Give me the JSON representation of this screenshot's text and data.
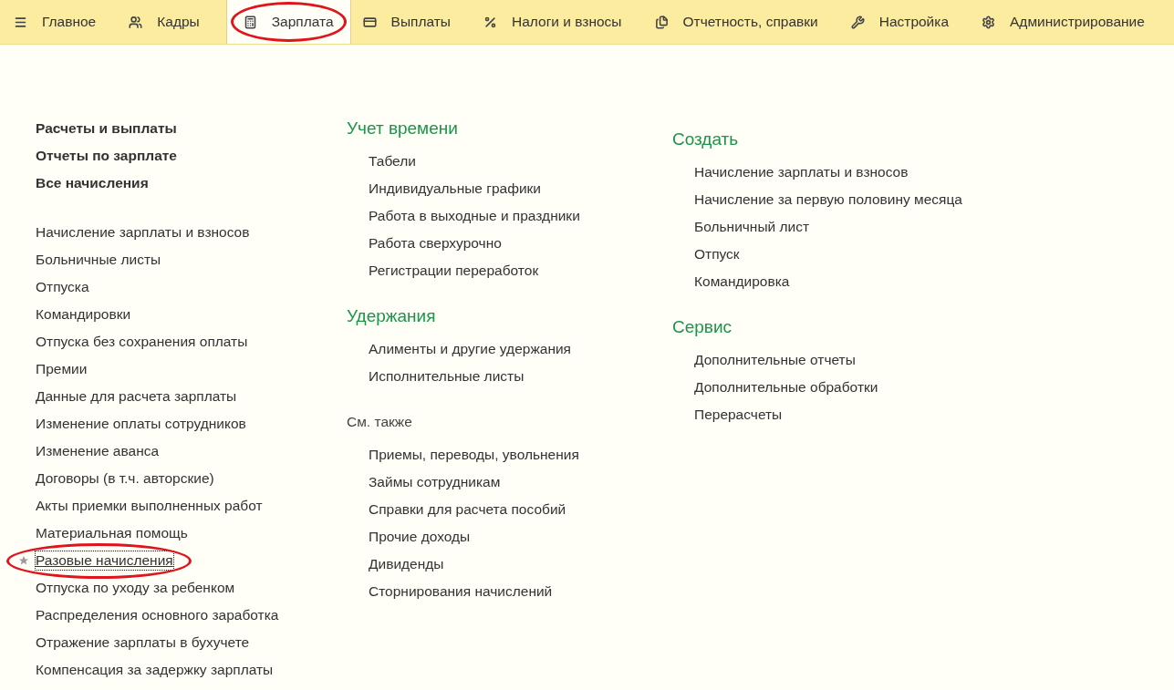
{
  "tabs": [
    {
      "label": "Главное",
      "selected": false,
      "circled": false
    },
    {
      "label": "Кадры",
      "selected": false,
      "circled": false
    },
    {
      "label": "Зарплата",
      "selected": true,
      "circled": true
    },
    {
      "label": "Выплаты",
      "selected": false,
      "circled": false
    },
    {
      "label": "Налоги и взносы",
      "selected": false,
      "circled": false
    },
    {
      "label": "Отчетность, справки",
      "selected": false,
      "circled": false
    },
    {
      "label": "Настройка",
      "selected": false,
      "circled": false
    },
    {
      "label": "Администрирование",
      "selected": false,
      "circled": false
    }
  ],
  "columns": [
    {
      "sections": [
        {
          "kind": "bold",
          "items": [
            {
              "label": "Расчеты и выплаты"
            },
            {
              "label": "Отчеты по зарплате"
            },
            {
              "label": "Все начисления"
            }
          ]
        },
        {
          "kind": "plain",
          "items": [
            {
              "label": "Начисление зарплаты и взносов"
            },
            {
              "label": "Больничные листы"
            },
            {
              "label": "Отпуска"
            },
            {
              "label": "Командировки"
            },
            {
              "label": "Отпуска без сохранения оплаты"
            },
            {
              "label": "Премии"
            },
            {
              "label": "Данные для расчета зарплаты"
            },
            {
              "label": "Изменение оплаты сотрудников"
            },
            {
              "label": "Изменение аванса"
            },
            {
              "label": "Договоры (в т.ч. авторские)"
            },
            {
              "label": "Акты приемки выполненных работ"
            },
            {
              "label": "Материальная помощь"
            },
            {
              "label": "Разовые начисления",
              "starred": true,
              "focused": true,
              "circled": true
            },
            {
              "label": "Отпуска по уходу за ребенком"
            },
            {
              "label": "Распределения основного заработка"
            },
            {
              "label": "Отражение зарплаты в бухучете"
            },
            {
              "label": "Компенсация за задержку зарплаты"
            }
          ]
        }
      ]
    },
    {
      "sections": [
        {
          "kind": "group",
          "title": "Учет времени",
          "items": [
            {
              "label": "Табели"
            },
            {
              "label": "Индивидуальные графики"
            },
            {
              "label": "Работа в выходные и праздники"
            },
            {
              "label": "Работа сверхурочно"
            },
            {
              "label": "Регистрации переработок"
            }
          ]
        },
        {
          "kind": "group",
          "title": "Удержания",
          "items": [
            {
              "label": "Алименты и другие удержания"
            },
            {
              "label": "Исполнительные листы"
            }
          ]
        },
        {
          "kind": "see",
          "title": "См. также",
          "items": [
            {
              "label": "Приемы, переводы, увольнения"
            },
            {
              "label": "Займы сотрудникам"
            },
            {
              "label": "Справки для расчета пособий"
            },
            {
              "label": "Прочие доходы"
            },
            {
              "label": "Дивиденды"
            },
            {
              "label": "Сторнирования начислений"
            }
          ]
        }
      ]
    },
    {
      "sections": [
        {
          "kind": "group",
          "title": "Создать",
          "items": [
            {
              "label": "Начисление зарплаты и взносов"
            },
            {
              "label": "Начисление за первую половину месяца"
            },
            {
              "label": "Больничный лист"
            },
            {
              "label": "Отпуск"
            },
            {
              "label": "Командировка"
            }
          ]
        },
        {
          "kind": "group",
          "title": "Сервис",
          "items": [
            {
              "label": "Дополнительные отчеты"
            },
            {
              "label": "Дополнительные обработки"
            },
            {
              "label": "Перерасчеты"
            }
          ]
        }
      ]
    }
  ]
}
